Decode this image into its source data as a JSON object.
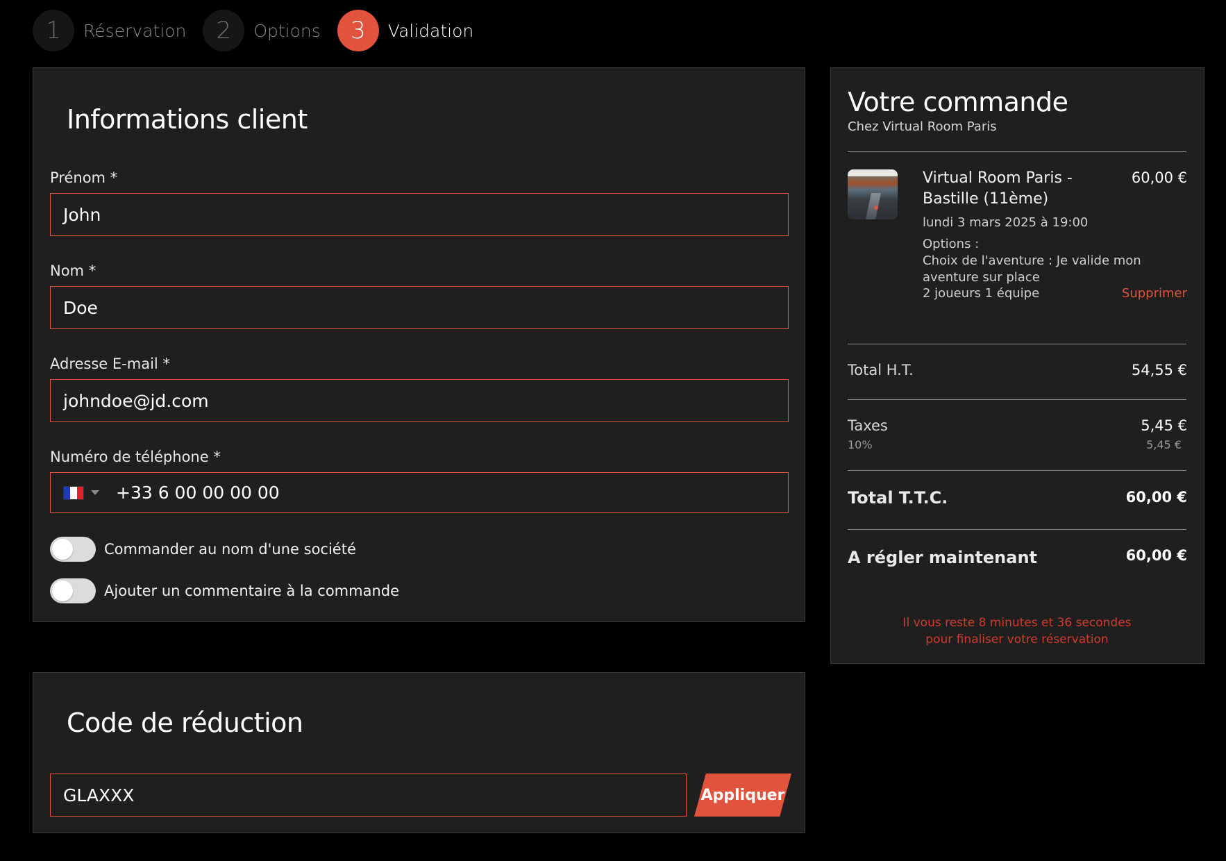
{
  "stepper": {
    "steps": [
      {
        "number": "1",
        "label": "Réservation"
      },
      {
        "number": "2",
        "label": "Options"
      },
      {
        "number": "3",
        "label": "Validation"
      }
    ]
  },
  "client_form": {
    "title": "Informations client",
    "first_name": {
      "label": "Prénom *",
      "value": "John"
    },
    "last_name": {
      "label": "Nom *",
      "value": "Doe"
    },
    "email": {
      "label": "Adresse E-mail *",
      "value": "johndoe@jd.com"
    },
    "phone": {
      "label": "Numéro de téléphone *",
      "value": "+33 6 00 00 00 00",
      "country_flag": "fr-flag-icon"
    },
    "toggles": [
      {
        "label": "Commander au nom d'une société"
      },
      {
        "label": "Ajouter un commentaire à la commande"
      }
    ]
  },
  "promo": {
    "title": "Code de réduction",
    "value": "GLAXXX",
    "apply_label": "Appliquer"
  },
  "order": {
    "title": "Votre commande",
    "subtitle": "Chez Virtual Room Paris",
    "item": {
      "name": "Virtual Room Paris - Bastille (11ème)",
      "price": "60,00 €",
      "date": "lundi 3 mars 2025 à 19:00",
      "options_title": "Options :",
      "options_text": "Choix de l'aventure : Je valide mon aventure sur place",
      "quantity": "2 joueurs  1 équipe",
      "remove_label": "Supprimer"
    },
    "total_ht_label": "Total H.T.",
    "total_ht_value": "54,55 €",
    "taxes_label": "Taxes",
    "taxes_value": "5,45 €",
    "tax_rate_label": "10%",
    "tax_rate_value": "5,45 €",
    "total_ttc_label": "Total T.T.C.",
    "total_ttc_value": "60,00 €",
    "pay_now_label": "A régler maintenant",
    "pay_now_value": "60,00 €",
    "timer_line1": "Il vous reste 8 minutes et 36 secondes",
    "timer_line2": "pour finaliser votre réservation"
  },
  "colors": {
    "accent": "#e2533e",
    "background": "#000000",
    "card": "#1f1f1f"
  }
}
